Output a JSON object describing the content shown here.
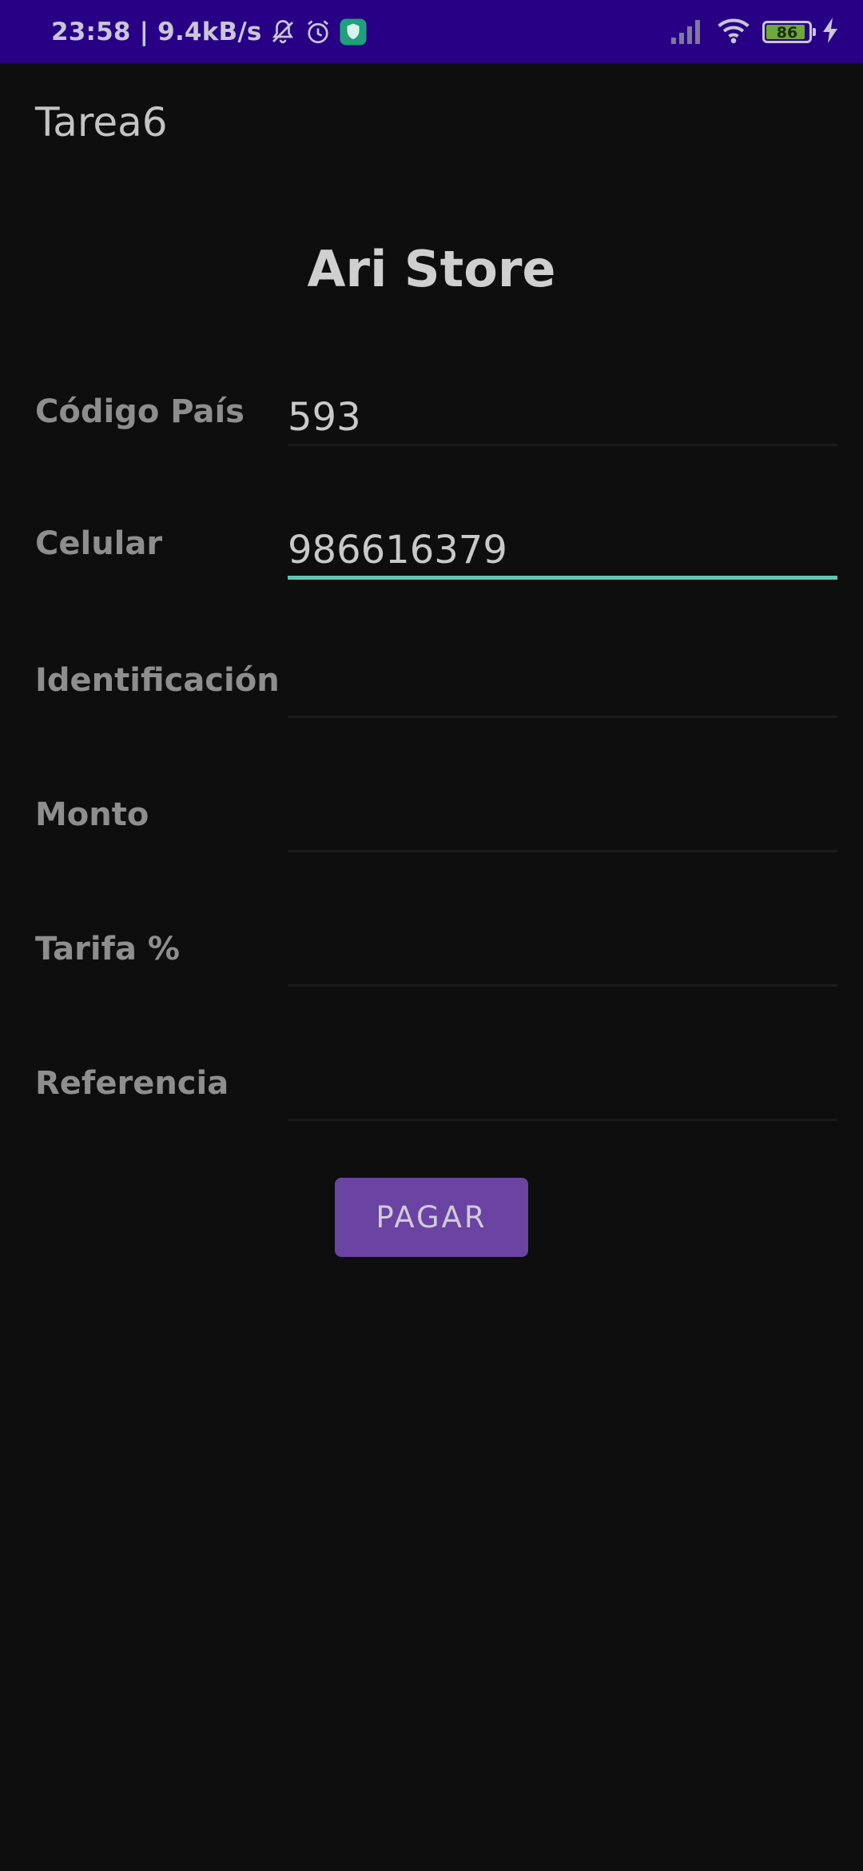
{
  "status_bar": {
    "time_speed": "23:58 | 9.4kB/s",
    "battery_level": "86",
    "background_color": "#270085",
    "icons": [
      "muted-bell-icon",
      "alarm-icon",
      "vpn-shield-icon",
      "signal-icon",
      "wifi-icon",
      "battery-icon",
      "charging-icon"
    ]
  },
  "app_bar": {
    "title": "Tarea6"
  },
  "main": {
    "store_title": "Ari Store",
    "fields": [
      {
        "label": "Código País",
        "value": "593"
      },
      {
        "label": "Celular",
        "value": "986616379"
      },
      {
        "label": "Identificación",
        "value": ""
      },
      {
        "label": "Monto",
        "value": ""
      },
      {
        "label": "Tarifa %",
        "value": ""
      },
      {
        "label": "Referencia",
        "value": ""
      }
    ],
    "pay_button_label": "PAGAR"
  },
  "colors": {
    "background": "#0e0e0e",
    "accent": "#5fc7b1",
    "button": "#6a43a3"
  }
}
